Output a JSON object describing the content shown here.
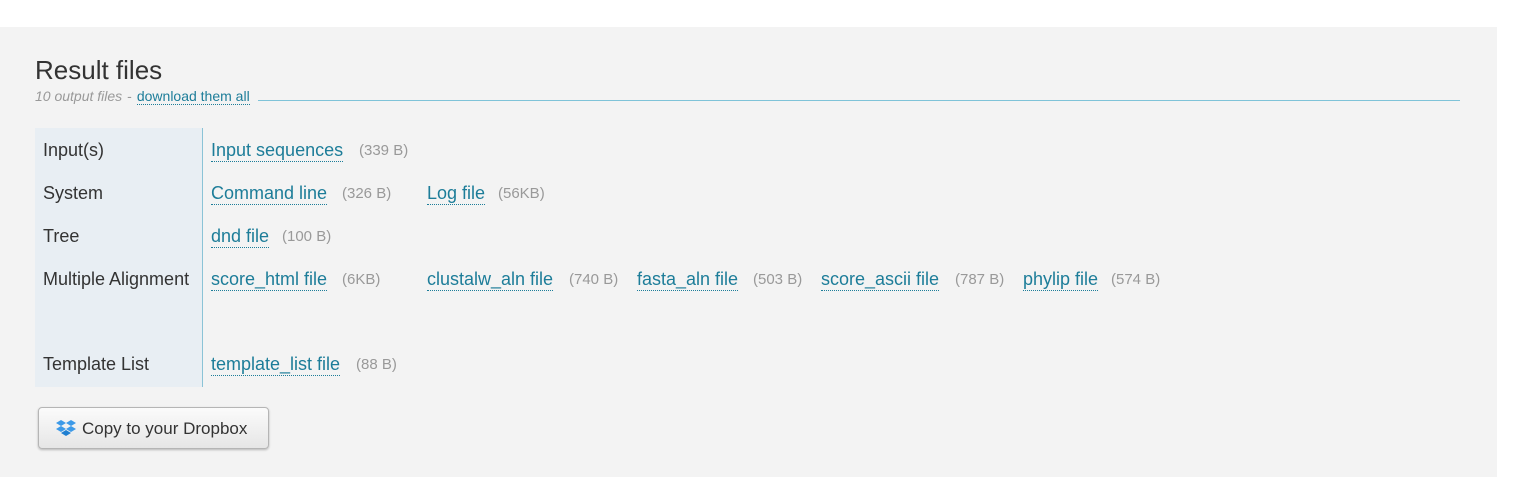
{
  "section": {
    "title": "Result files",
    "count_text": "10 output files",
    "separator": "-",
    "download_all": "download them all"
  },
  "rows": [
    {
      "label": "Input(s)",
      "files": [
        {
          "name": "Input sequences",
          "size": "(339 B)"
        }
      ]
    },
    {
      "label": "System",
      "files": [
        {
          "name": "Command line",
          "size": "(326 B)"
        },
        {
          "name": "Log file",
          "size": "(56KB)"
        }
      ]
    },
    {
      "label": "Tree",
      "files": [
        {
          "name": "dnd file",
          "size": "(100 B)"
        }
      ]
    },
    {
      "label": "Multiple Alignment",
      "files": [
        {
          "name": "score_html file",
          "size": "(6KB)"
        },
        {
          "name": "clustalw_aln file",
          "size": "(740 B)"
        },
        {
          "name": "fasta_aln file",
          "size": "(503 B)"
        },
        {
          "name": "score_ascii file",
          "size": "(787 B)"
        },
        {
          "name": "phylip file",
          "size": "(574 B)"
        }
      ]
    },
    {
      "label": "Template List",
      "files": [
        {
          "name": "template_list file",
          "size": "(88 B)"
        }
      ]
    }
  ],
  "dropbox_button": {
    "label": "Copy to your Dropbox",
    "icon": "dropbox-icon"
  },
  "colors": {
    "link": "#1d7d99",
    "rule": "#7fc3d8",
    "label_bg": "#e8eef3",
    "panel_bg": "#f3f3f3"
  }
}
